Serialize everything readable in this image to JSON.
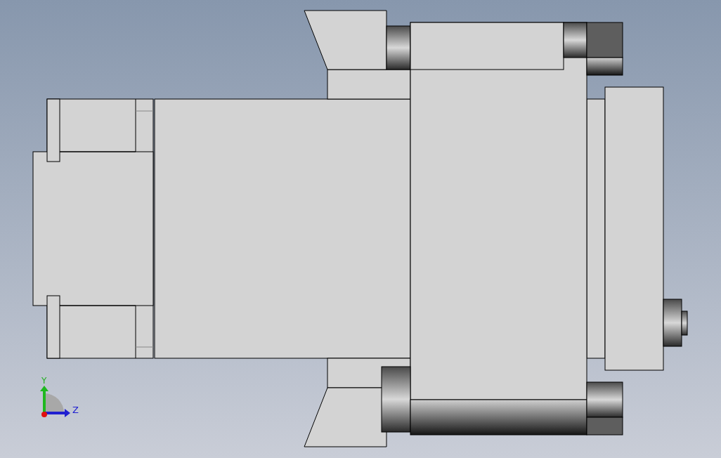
{
  "triad": {
    "y_label": "Y",
    "z_label": "Z"
  }
}
